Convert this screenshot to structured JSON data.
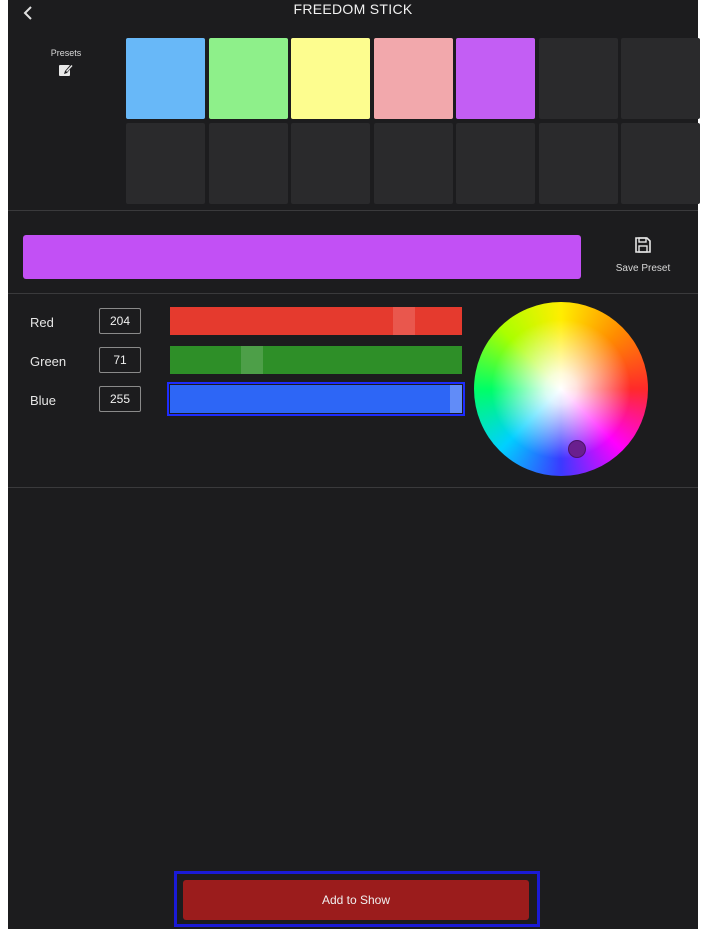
{
  "header": {
    "title": "FREEDOM STICK"
  },
  "presets": {
    "label": "Presets",
    "swatches": [
      {
        "color": "#68b8f8"
      },
      {
        "color": "#8ef08a"
      },
      {
        "color": "#fdfd8f"
      },
      {
        "color": "#f2a8ac"
      },
      {
        "color": "#c35ef4"
      },
      {
        "color": "#2a2a2c"
      },
      {
        "color": "#2a2a2c"
      },
      {
        "color": "#2a2a2c"
      },
      {
        "color": "#2a2a2c"
      },
      {
        "color": "#2a2a2c"
      },
      {
        "color": "#2a2a2c"
      },
      {
        "color": "#2a2a2c"
      },
      {
        "color": "#2a2a2c"
      },
      {
        "color": "#2a2a2c"
      }
    ]
  },
  "current_color": {
    "hex": "#c250f5"
  },
  "save_preset": {
    "label": "Save Preset"
  },
  "rgb": {
    "red": {
      "label": "Red",
      "value": "204",
      "track_color": "#e53a2e",
      "level": 0.8
    },
    "green": {
      "label": "Green",
      "value": "71",
      "track_color": "#2e8f28",
      "level": 0.28
    },
    "blue": {
      "label": "Blue",
      "value": "255",
      "track_color": "#2d66f6",
      "level": 1.0
    }
  },
  "add_to_show": {
    "label": "Add to Show"
  }
}
